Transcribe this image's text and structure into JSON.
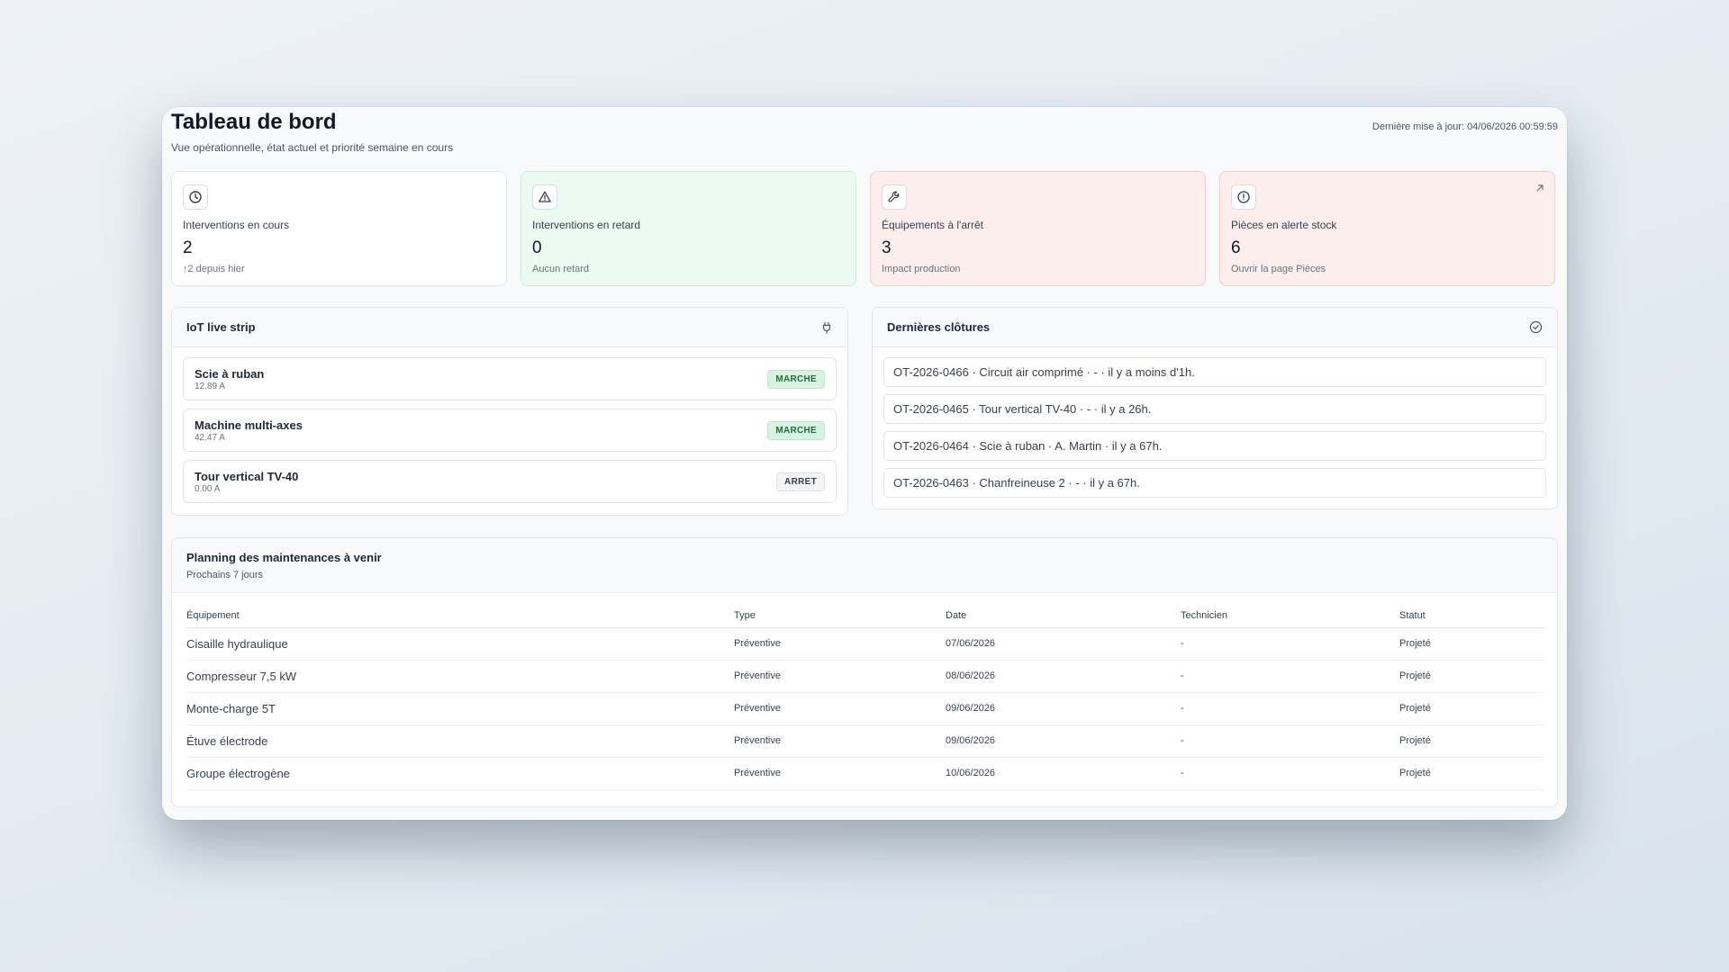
{
  "header": {
    "title": "Tableau de bord",
    "subtitle": "Vue opérationnelle, état actuel et priorité semaine en cours",
    "last_update": "Dernière mise à jour: 04/06/2026 00:59:59"
  },
  "kpis": [
    {
      "label": "Interventions en cours",
      "value": "2",
      "note": "↑2 depuis hier",
      "icon": "clock-icon",
      "tone": "neutral"
    },
    {
      "label": "Interventions en retard",
      "value": "0",
      "note": "Aucun retard",
      "icon": "warning-triangle-icon",
      "tone": "green"
    },
    {
      "label": "Équipements à l'arrêt",
      "value": "3",
      "note": "Impact production",
      "icon": "wrench-icon",
      "tone": "red"
    },
    {
      "label": "Pièces en alerte stock",
      "value": "6",
      "note": "Ouvrir la page Pièces",
      "icon": "alert-circle-icon",
      "tone": "red",
      "link_icon": "arrow-up-right-icon"
    }
  ],
  "iot": {
    "title": "IoT live strip",
    "icon": "plug-icon",
    "items": [
      {
        "name": "Scie à ruban",
        "current": "12.89 A",
        "status": "MARCHE"
      },
      {
        "name": "Machine multi-axes",
        "current": "42.47 A",
        "status": "MARCHE"
      },
      {
        "name": "Tour vertical TV-40",
        "current": "0.00 A",
        "status": "ARRET"
      }
    ]
  },
  "closures": {
    "title": "Dernières clôtures",
    "icon": "check-circle-icon",
    "items": [
      "OT-2026-0466 · Circuit air comprimé · - · il y a moins d'1h.",
      "OT-2026-0465 · Tour vertical TV-40 · - · il y a 26h.",
      "OT-2026-0464 · Scie à ruban · A. Martin · il y a 67h.",
      "OT-2026-0463 · Chanfreineuse 2 · - · il y a 67h."
    ]
  },
  "planning": {
    "title": "Planning des maintenances à venir",
    "subtitle": "Prochains 7 jours",
    "columns": [
      "Équipement",
      "Type",
      "Date",
      "Technicien",
      "Statut"
    ],
    "rows": [
      [
        "Cisaille hydraulique",
        "Préventive",
        "07/06/2026",
        "-",
        "Projeté"
      ],
      [
        "Compresseur 7,5 kW",
        "Préventive",
        "08/06/2026",
        "-",
        "Projeté"
      ],
      [
        "Monte-charge 5T",
        "Préventive",
        "09/06/2026",
        "-",
        "Projeté"
      ],
      [
        "Étuve électrode",
        "Préventive",
        "09/06/2026",
        "-",
        "Projeté"
      ],
      [
        "Groupe électrogène",
        "Préventive",
        "10/06/2026",
        "-",
        "Projeté"
      ]
    ]
  }
}
